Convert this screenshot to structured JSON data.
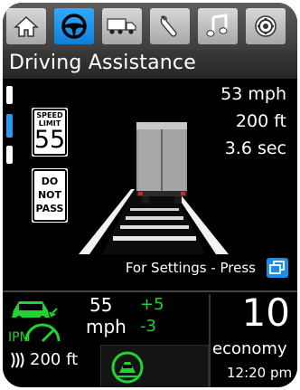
{
  "tabs": [
    {
      "name": "home-icon",
      "active": false
    },
    {
      "name": "steering-wheel-icon",
      "active": true
    },
    {
      "name": "truck-icon",
      "active": false
    },
    {
      "name": "wrench-icon",
      "active": false
    },
    {
      "name": "music-icon",
      "active": false
    },
    {
      "name": "settings-gear-icon",
      "active": false
    }
  ],
  "header": {
    "title": "Driving Assistance"
  },
  "speed_sign": {
    "line1": "SPEED",
    "line2": "LIMIT",
    "value": "55"
  },
  "no_pass_sign": {
    "line1": "DO",
    "line2": "NOT",
    "line3": "PASS"
  },
  "stats": {
    "speed": "53  mph",
    "distance": "200  ft",
    "time": "3.6  sec"
  },
  "settings_hint": "For Settings - Press",
  "cruise": {
    "label": "IPM",
    "set_speed": "55",
    "unit": "mph",
    "plus": "+5",
    "minus": "-3",
    "follow_distance": "200 ft"
  },
  "economy": {
    "value": "10",
    "label": "economy"
  },
  "clock": "12:20 pm",
  "colors": {
    "accent_blue": "#1a8ee8",
    "active_green": "#1fd331",
    "tab_gray": "#c0c0c0"
  }
}
